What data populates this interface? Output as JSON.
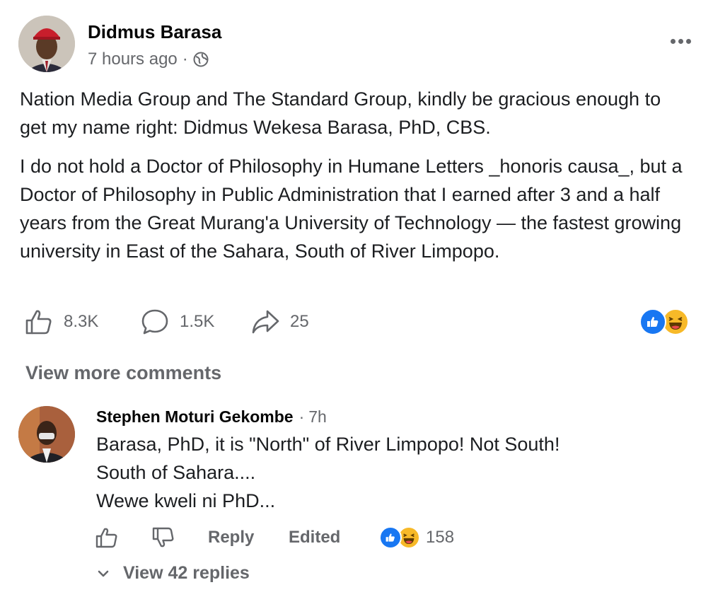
{
  "post": {
    "author": "Didmus Barasa",
    "time": "7 hours ago",
    "separator": "·",
    "paragraphs": [
      "Nation Media Group and The Standard Group, kindly be gracious enough to get my name right: Didmus Wekesa Barasa, PhD, CBS.",
      "I do not hold a Doctor of Philosophy in Humane Letters _honoris causa_, but a Doctor of Philosophy in Public Administration that I earned after 3 and a half years from the Great Murang'a University of Technology — the fastest growing university in East of the Sahara, South of River Limpopo."
    ],
    "likes": "8.3K",
    "comments": "1.5K",
    "shares": "25"
  },
  "view_more_comments": "View more comments",
  "comment": {
    "author": "Stephen Moturi Gekombe",
    "separator": "·",
    "time": "7h",
    "text": "Barasa, PhD, it is \"North\" of River Limpopo! Not South!\nSouth of Sahara....\nWewe kweli ni PhD...",
    "reply_label": "Reply",
    "edited_label": "Edited",
    "reaction_count": "158",
    "view_replies": "View 42 replies"
  },
  "colors": {
    "like_blue": "#1877f2",
    "haha_yellow": "#f7b928",
    "secondary_text": "#65676b"
  }
}
